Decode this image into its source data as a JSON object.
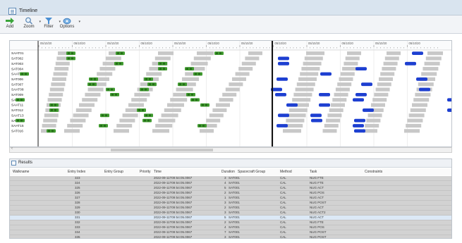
{
  "window": {
    "title": "Timeline"
  },
  "toolbar": {
    "buttons": [
      {
        "label": "Add",
        "icon": "add-green-arrow-icon"
      },
      {
        "label": "Zoom",
        "icon": "magnifier-icon"
      },
      {
        "label": "Filter",
        "icon": "funnel-icon"
      },
      {
        "label": "Options",
        "icon": "options-icon"
      }
    ]
  },
  "gantt": {
    "rows": [
      "SAAT01",
      "SAT002",
      "SAT003",
      "SAT004",
      "SAAT05",
      "SAT006",
      "SAT007",
      "SAAT08",
      "SAT009",
      "SAT010",
      "SAAT11",
      "SAT012",
      "SAAT13",
      "SAT014",
      "SAAT15",
      "SAT016"
    ],
    "time_labels": [
      "05/10/20",
      "05/10/20",
      "05/10/20",
      "05/10/20",
      "05/10/20",
      "05/10/20",
      "05/10/20",
      "05/10/20",
      "05/10/20",
      "05/10/20",
      "05/10/20",
      "05/10/20"
    ],
    "colors": {
      "gray": "#c8c8c8",
      "green": "#3f9a2e",
      "green_dark": "#246b18",
      "blue": "#1d3fd1",
      "marker": "#111111"
    }
  },
  "results": {
    "tab_label": "Results",
    "columns": [
      "Walkname",
      "Entry Index",
      "Entry Group",
      "Priority",
      "Time",
      "Duration",
      "Spacecraft Group",
      "Method",
      "Task",
      "Constraints"
    ],
    "rows": [
      {
        "index": "323",
        "time": "2022-09-11T09:54:05.0067",
        "duration": "3",
        "group": "SAT001",
        "method": "CAL",
        "task": "NUG FTE"
      },
      {
        "index": "324",
        "time": "2022-09-11T09:54:05.0067",
        "duration": "4",
        "group": "SAT001",
        "method": "CAL",
        "task": "NUG FTE"
      },
      {
        "index": "325",
        "time": "2022-09-11T09:54:05.0067",
        "duration": "5",
        "group": "SAT001",
        "method": "CAL",
        "task": "NUG ACT"
      },
      {
        "index": "326",
        "time": "2022-09-11T09:54:05.0067",
        "duration": "2",
        "group": "SAT001",
        "method": "CAL",
        "task": "NUG POS"
      },
      {
        "index": "327",
        "time": "2022-09-11T09:54:05.0067",
        "duration": "1",
        "group": "SAT001",
        "method": "CAL",
        "task": "NUG ACT"
      },
      {
        "index": "328",
        "time": "2022-09-11T09:54:05.0067",
        "duration": "3",
        "group": "SAT001",
        "method": "CAL",
        "task": "NUG POST"
      },
      {
        "index": "329",
        "time": "2022-09-11T09:54:05.0067",
        "duration": "2",
        "group": "SAT001",
        "method": "CAL",
        "task": "NUG ACT"
      },
      {
        "index": "330",
        "time": "2022-09-11T09:54:05.0067",
        "duration": "3",
        "group": "SAT001",
        "method": "CAL",
        "task": "NUG ACT2"
      },
      {
        "index": "331",
        "time": "2022-09-11T09:54:05.0067",
        "duration": "5",
        "group": "SAT001",
        "method": "CAL",
        "task": "NUG ACT"
      },
      {
        "index": "332",
        "time": "2022-09-11T09:54:05.0067",
        "duration": "2",
        "group": "SAT001",
        "method": "CAL",
        "task": "NUG FTE"
      },
      {
        "index": "333",
        "time": "2022-09-11T09:54:05.0067",
        "duration": "4",
        "group": "SAT001",
        "method": "CAL",
        "task": "NUG POS"
      },
      {
        "index": "334",
        "time": "2022-09-11T09:54:05.0067",
        "duration": "7",
        "group": "SAT001",
        "method": "CAL",
        "task": "NUG POST"
      },
      {
        "index": "335",
        "time": "2022-09-11T09:54:05.0067",
        "duration": "3",
        "group": "SAT001",
        "method": "CAL",
        "task": "NUG POST"
      },
      {
        "index": "336",
        "time": "2022-09-11T09:54:05.0067",
        "duration": "2",
        "group": "SAT001",
        "method": "CAL",
        "task": "NUG ACT2"
      },
      {
        "index": "337",
        "time": "2022-09-11T09:54:05.0067",
        "duration": "1",
        "group": "SAT001",
        "method": "CAL",
        "task": "NUG POST"
      }
    ],
    "selected_row": 8
  }
}
